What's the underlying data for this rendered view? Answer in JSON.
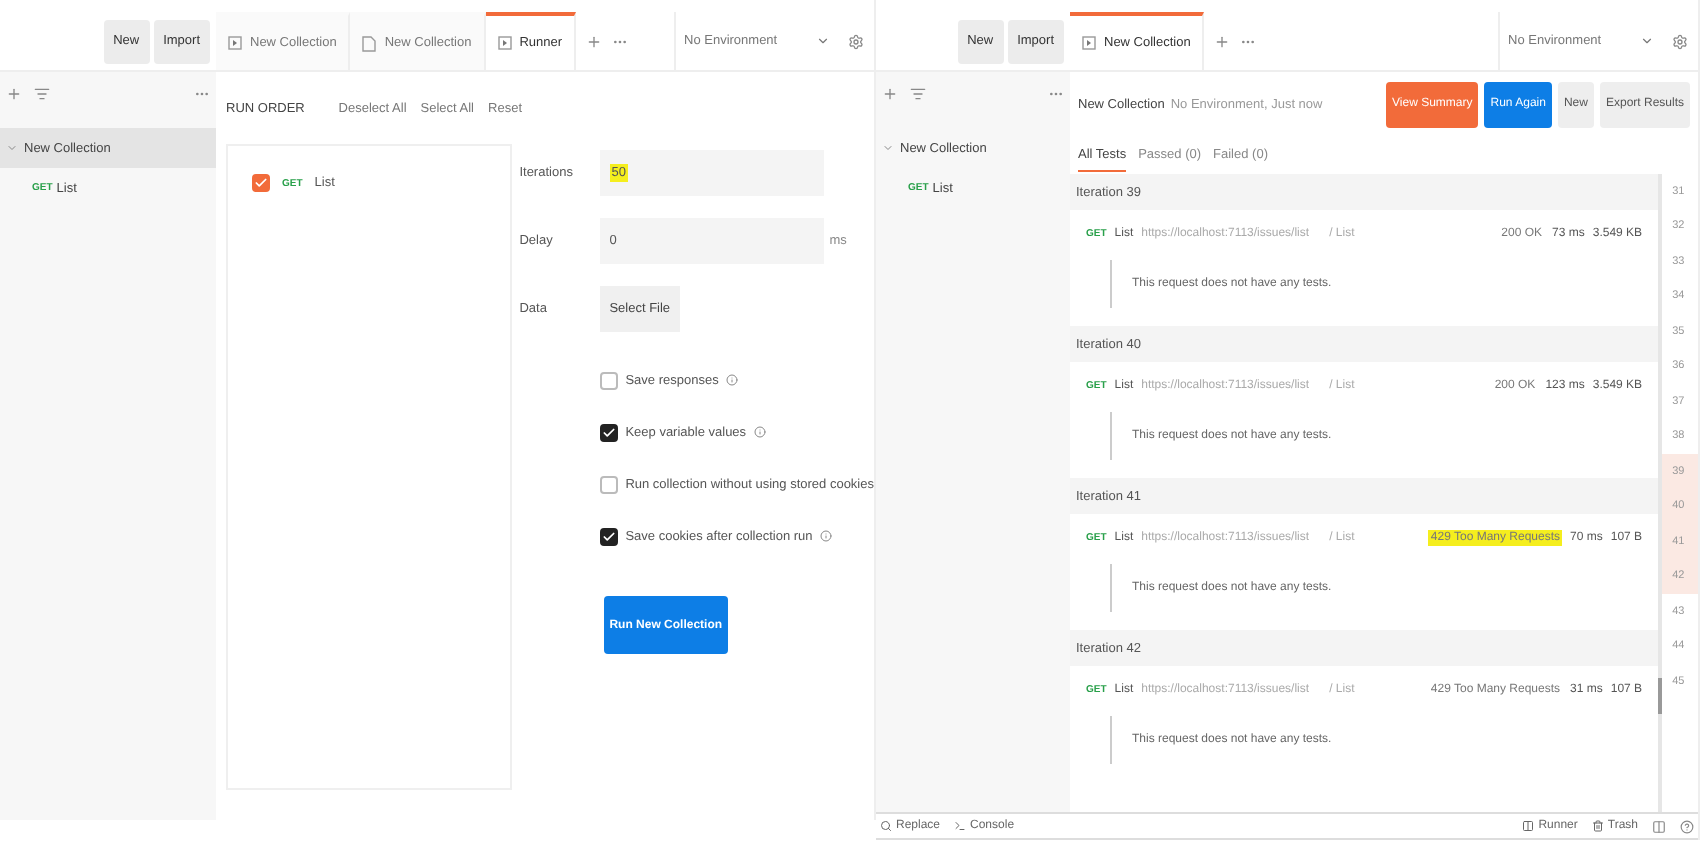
{
  "left": {
    "top_bar": {
      "buttons": [
        "New",
        "Import"
      ]
    },
    "tabs": [
      {
        "label": "New Collection",
        "kind": "collection",
        "selected": false
      },
      {
        "label": "New Collection",
        "kind": "request",
        "selected": false
      },
      {
        "label": "Runner",
        "kind": "runner",
        "selected": true
      }
    ],
    "environment": "No Environment",
    "sidebar": {
      "items": [
        {
          "label": "New Collection",
          "expanded": true,
          "selected": true,
          "children": [
            {
              "method": "GET",
              "label": "List"
            }
          ]
        }
      ]
    },
    "run_order": {
      "title": "RUN ORDER",
      "actions": [
        "Deselect All",
        "Select All",
        "Reset"
      ],
      "items": [
        {
          "method": "GET",
          "label": "List",
          "checked": true
        }
      ]
    },
    "settings": {
      "iterations": {
        "label": "Iterations",
        "value": "50",
        "highlighted": true
      },
      "delay": {
        "label": "Delay",
        "value": "0",
        "unit": "ms"
      },
      "data": {
        "label": "Data",
        "button": "Select File"
      },
      "options": [
        {
          "label": "Save responses",
          "checked": false,
          "info": true
        },
        {
          "label": "Keep variable values",
          "checked": true,
          "info": true
        },
        {
          "label": "Run collection without using stored cookies",
          "checked": false,
          "info": false
        },
        {
          "label": "Save cookies after collection run",
          "checked": true,
          "info": true
        }
      ],
      "run_button": "Run New Collection"
    }
  },
  "right": {
    "top_bar": {
      "buttons": [
        "New",
        "Import"
      ]
    },
    "tabs": [
      {
        "label": "New Collection",
        "kind": "runner",
        "selected": true
      }
    ],
    "environment": "No Environment",
    "sidebar": {
      "items": [
        {
          "label": "New Collection",
          "expanded": true,
          "selected": false,
          "children": [
            {
              "method": "GET",
              "label": "List"
            }
          ]
        }
      ]
    },
    "run_header": {
      "title": "New Collection",
      "meta": "No Environment, Just now",
      "buttons": [
        {
          "label": "View Summary",
          "kind": "warning"
        },
        {
          "label": "Run Again",
          "kind": "primary"
        },
        {
          "label": "New",
          "kind": "plain"
        },
        {
          "label": "Export Results",
          "kind": "plain"
        }
      ]
    },
    "result_tabs": [
      {
        "label": "All Tests",
        "selected": true
      },
      {
        "label": "Passed (0)",
        "selected": false
      },
      {
        "label": "Failed (0)",
        "selected": false
      }
    ],
    "iterations": [
      {
        "title": "Iteration 39",
        "request": {
          "method": "GET",
          "name": "List",
          "url": "https://localhost:7113/issues/list",
          "path": "/ List",
          "status": "200 OK",
          "highlighted": false,
          "time": "73 ms",
          "size": "3.549 KB",
          "note": "This request does not have any tests."
        }
      },
      {
        "title": "Iteration 40",
        "request": {
          "method": "GET",
          "name": "List",
          "url": "https://localhost:7113/issues/list",
          "path": "/ List",
          "status": "200 OK",
          "highlighted": false,
          "time": "123 ms",
          "size": "3.549 KB",
          "note": "This request does not have any tests."
        }
      },
      {
        "title": "Iteration 41",
        "request": {
          "method": "GET",
          "name": "List",
          "url": "https://localhost:7113/issues/list",
          "path": "/ List",
          "status": "429 Too Many Requests",
          "highlighted": true,
          "time": "70 ms",
          "size": "107 B",
          "note": "This request does not have any tests."
        }
      },
      {
        "title": "Iteration 42",
        "request": {
          "method": "GET",
          "name": "List",
          "url": "https://localhost:7113/issues/list",
          "path": "/ List",
          "status": "429 Too Many Requests",
          "highlighted": false,
          "time": "31 ms",
          "size": "107 B",
          "note": "This request does not have any tests."
        }
      }
    ],
    "line_numbers": [
      {
        "number": "31",
        "highlighted": false
      },
      {
        "number": "32",
        "highlighted": false
      },
      {
        "number": "33",
        "highlighted": false
      },
      {
        "number": "34",
        "highlighted": false
      },
      {
        "number": "35",
        "highlighted": false
      },
      {
        "number": "36",
        "highlighted": false
      },
      {
        "number": "37",
        "highlighted": false
      },
      {
        "number": "38",
        "highlighted": false
      },
      {
        "number": "39",
        "highlighted": true
      },
      {
        "number": "40",
        "highlighted": true
      },
      {
        "number": "41",
        "highlighted": true
      },
      {
        "number": "42",
        "highlighted": true
      },
      {
        "number": "43",
        "highlighted": false
      },
      {
        "number": "44",
        "highlighted": false
      },
      {
        "number": "45",
        "highlighted": false
      }
    ],
    "footer": {
      "left": [
        {
          "label": "Replace",
          "kind": "replace"
        },
        {
          "label": "Console",
          "kind": "console"
        }
      ],
      "right": [
        {
          "label": "Runner",
          "kind": "runner"
        },
        {
          "label": "Trash",
          "kind": "trash"
        }
      ]
    }
  }
}
